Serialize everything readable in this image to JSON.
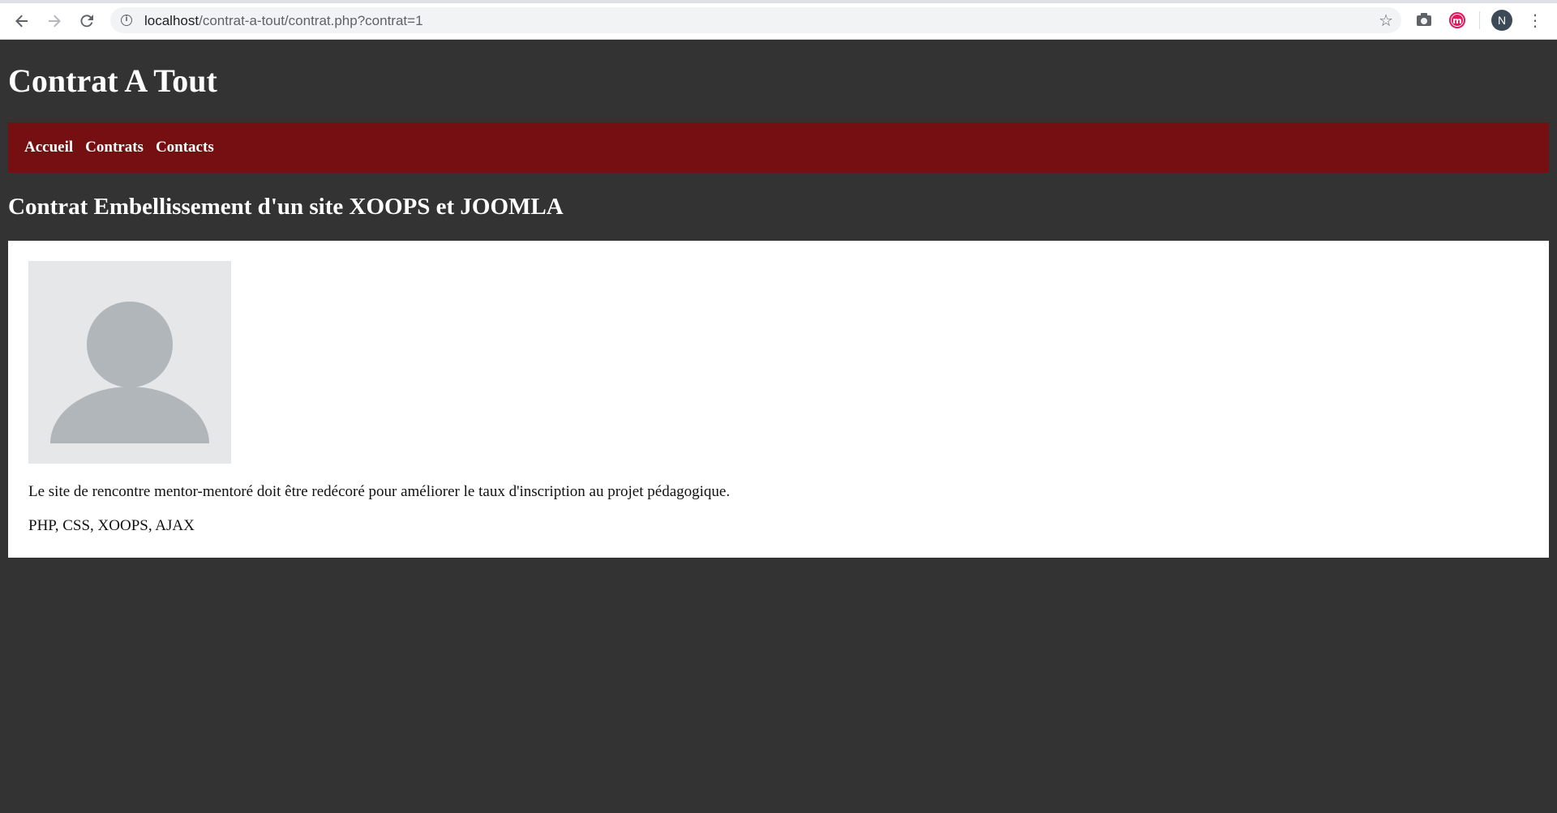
{
  "browser": {
    "url_host": "localhost",
    "url_path": "/contrat-a-tout/contrat.php?contrat=1",
    "profile_initial": "N",
    "extension_letter": "m",
    "icons": {
      "back": "arrow-left-icon",
      "forward": "arrow-right-icon",
      "reload": "reload-icon",
      "site_info": "info-icon",
      "bookmark": "star-icon",
      "screenshot": "camera-icon",
      "extension": "extension-icon",
      "menu": "more-vertical-icon"
    }
  },
  "site": {
    "title": "Contrat A Tout",
    "nav": [
      {
        "label": "Accueil"
      },
      {
        "label": "Contrats"
      },
      {
        "label": "Contacts"
      }
    ]
  },
  "contract": {
    "title": "Contrat Embellissement d'un site XOOPS et JOOMLA",
    "image_icon": "user-placeholder-icon",
    "description": "Le site de rencontre mentor-mentoré doit être redécoré pour améliorer le taux d'inscription au projet pédagogique.",
    "skills": "PHP, CSS, XOOPS, AJAX"
  },
  "colors": {
    "page_background": "#333333",
    "nav_background": "#760f12",
    "card_background": "#ffffff",
    "placeholder_background": "#e5e7e9",
    "placeholder_figure": "#b1b6bb"
  }
}
